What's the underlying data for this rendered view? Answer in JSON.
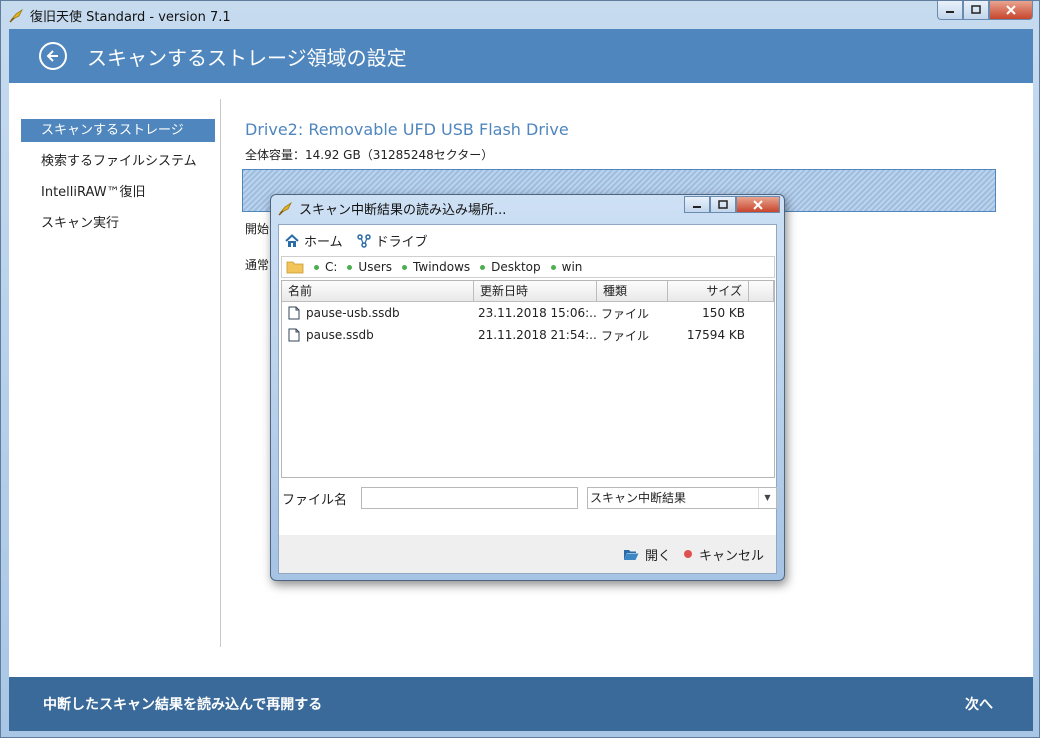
{
  "app": {
    "title": "復旧天使 Standard - version 7.1"
  },
  "header": {
    "title": "スキャンするストレージ領域の設定"
  },
  "sidebar": {
    "items": [
      {
        "label": "スキャンするストレージ",
        "active": true
      },
      {
        "label": "検索するファイルシステム"
      },
      {
        "label": "IntelliRAW™復旧"
      },
      {
        "label": "スキャン実行"
      }
    ]
  },
  "main": {
    "drive_title": "Drive2: Removable UFD USB Flash Drive",
    "capacity": "全体容量：14.92 GB（31285248セクター）",
    "start_label": "開始",
    "normal_label": "通常"
  },
  "footer": {
    "left_label": "中断したスキャン結果を読み込んで再開する",
    "next_label": "次へ"
  },
  "dialog": {
    "title": "スキャン中断結果の読み込み場所...",
    "nav": {
      "home": "ホーム",
      "drive": "ドライブ"
    },
    "path": [
      "C:",
      "Users",
      "Twindows",
      "Desktop",
      "win"
    ],
    "columns": {
      "name": "名前",
      "modified": "更新日時",
      "type": "種類",
      "size": "サイズ"
    },
    "files": [
      {
        "name": "pause-usb.ssdb",
        "modified": "23.11.2018 15:06:...",
        "type": "ファイル",
        "size": "150 KB"
      },
      {
        "name": "pause.ssdb",
        "modified": "21.11.2018 21:54:...",
        "type": "ファイル",
        "size": "17594 KB"
      }
    ],
    "filename_label": "ファイル名",
    "filename_value": "",
    "filetype_selected": "スキャン中断結果",
    "open_label": "開く",
    "cancel_label": "キャンセル"
  },
  "colors": {
    "accent": "#4f86bd",
    "footer": "#3a6a99",
    "cancel": "#e05050",
    "path_dot": "#4caf50"
  }
}
